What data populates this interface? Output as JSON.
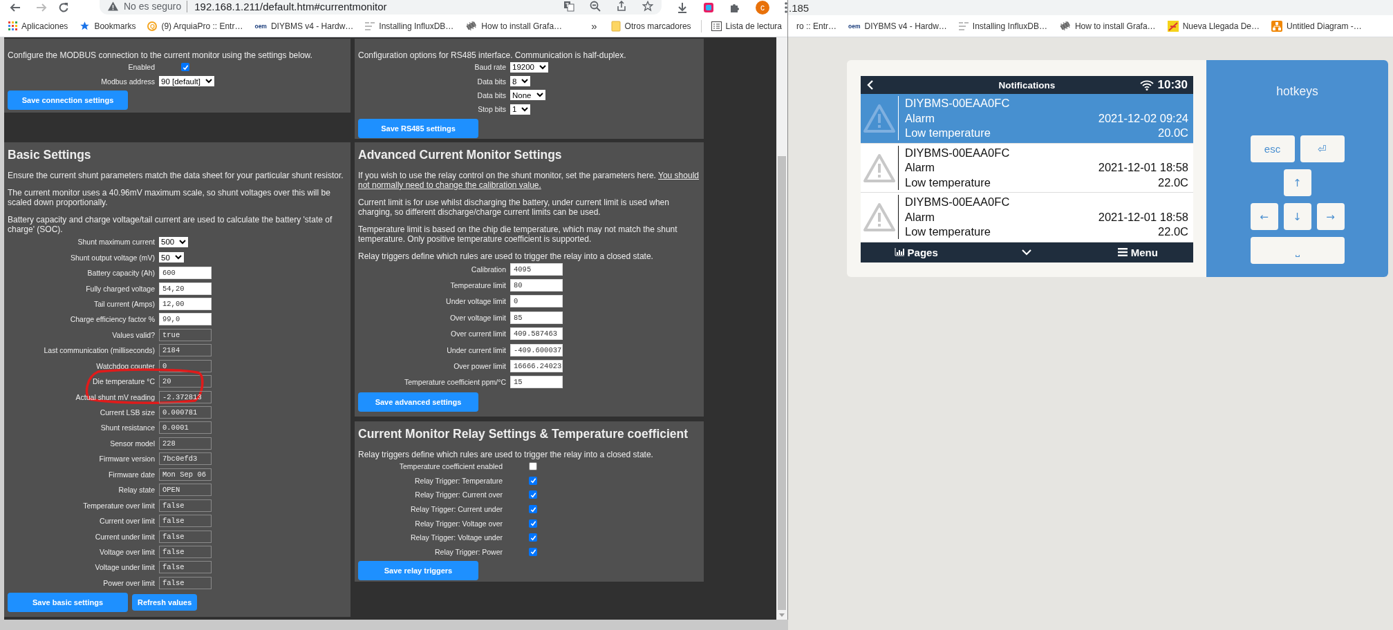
{
  "browser": {
    "security_label": "No es seguro",
    "url": "192.168.1.211/default.htm#currentmonitor",
    "profile_initial": "c",
    "bookmarks": [
      {
        "label": "Aplicaciones"
      },
      {
        "label": "Bookmarks"
      },
      {
        "label": "(9) ArquiaPro :: Entr…",
        "icon_text": "Q"
      },
      {
        "label": "DIYBMS v4 - Hardw…",
        "icon_text": "oem"
      },
      {
        "label": "Installing InfluxDB…"
      },
      {
        "label": "How to install Grafa…"
      }
    ],
    "overflow": "»",
    "other_bookmarks": "Otros marcadores",
    "reading_list": "Lista de lectura"
  },
  "modbus_panel": {
    "paragraphs": [
      {
        "text": "Configure the MODBUS connection to the current monitor using the settings below."
      }
    ],
    "fields": [
      {
        "kind": "checkbox",
        "label": "Enabled",
        "checked": true
      },
      {
        "kind": "select",
        "label": "Modbus address",
        "value": "90 [default]"
      }
    ],
    "buttons": [
      {
        "label": "Save connection settings",
        "kind": "wide"
      }
    ]
  },
  "rs485_panel": {
    "paragraphs": [
      {
        "text": "Configuration options for RS485 interface. Communication is half-duplex."
      }
    ],
    "fields": [
      {
        "kind": "select",
        "label": "Baud rate",
        "value": "19200"
      },
      {
        "kind": "select",
        "label": "Data bits",
        "value": "8"
      },
      {
        "kind": "select",
        "label": "Data bits",
        "value": "None"
      },
      {
        "kind": "select",
        "label": "Stop bits",
        "value": "1"
      }
    ],
    "buttons": [
      {
        "label": "Save RS485 settings",
        "kind": "wide"
      }
    ]
  },
  "basic_settings": {
    "title": "Basic Settings",
    "paragraphs": [
      {
        "text": "Ensure the current shunt parameters match the data sheet for your particular shunt resistor."
      },
      {
        "text": "The current monitor uses a 40.96mV maximum scale, so shunt voltages over this will be scaled down proportionally."
      },
      {
        "text": "Battery capacity and charge voltage/tail current are used to calculate the battery 'state of charge' (SOC)."
      }
    ],
    "fields": [
      {
        "kind": "select",
        "label": "Shunt maximum current",
        "value": "500"
      },
      {
        "kind": "select",
        "label": "Shunt output voltage (mV)",
        "value": "50"
      },
      {
        "kind": "input",
        "label": "Battery capacity (Ah)",
        "value": "600"
      },
      {
        "kind": "input",
        "label": "Fully charged voltage",
        "value": "54,20"
      },
      {
        "kind": "input",
        "label": "Tail current (Amps)",
        "value": "12,00"
      },
      {
        "kind": "input",
        "label": "Charge efficiency factor %",
        "value": "99,0"
      },
      {
        "kind": "readonly",
        "label": "Values valid?",
        "value": "true"
      },
      {
        "kind": "readonly",
        "label": "Last communication (milliseconds)",
        "value": "2184"
      },
      {
        "kind": "readonly",
        "label": "Watchdog counter",
        "value": "0"
      },
      {
        "kind": "readonly",
        "label": "Die temperature °C",
        "value": "20",
        "circled": true
      },
      {
        "kind": "readonly",
        "label": "Actual shunt mV reading",
        "value": "-2.372813"
      },
      {
        "kind": "readonly",
        "label": "Current LSB size",
        "value": "0.000781"
      },
      {
        "kind": "readonly",
        "label": "Shunt resistance",
        "value": "0.0001"
      },
      {
        "kind": "readonly",
        "label": "Sensor model",
        "value": "228"
      },
      {
        "kind": "readonly",
        "label": "Firmware version",
        "value": "7bc0efd3"
      },
      {
        "kind": "readonly",
        "label": "Firmware date",
        "value": "Mon Sep 06"
      },
      {
        "kind": "readonly",
        "label": "Relay state",
        "value": "OPEN"
      },
      {
        "kind": "readonly",
        "label": "Temperature over limit",
        "value": "false"
      },
      {
        "kind": "readonly",
        "label": "Current over limit",
        "value": "false"
      },
      {
        "kind": "readonly",
        "label": "Current under limit",
        "value": "false"
      },
      {
        "kind": "readonly",
        "label": "Voltage over limit",
        "value": "false"
      },
      {
        "kind": "readonly",
        "label": "Voltage under limit",
        "value": "false"
      },
      {
        "kind": "readonly",
        "label": "Power over limit",
        "value": "false"
      }
    ],
    "buttons": [
      {
        "label": "Save basic settings",
        "kind": "wide"
      },
      {
        "label": "Refresh values",
        "kind": "compact"
      }
    ]
  },
  "advanced_settings": {
    "title": "Advanced Current Monitor Settings",
    "paragraphs": [
      {
        "text": "If you wish to use the relay control on the shunt monitor, set the parameters here.",
        "underlined": "You should not normally need to change the calibration value."
      },
      {
        "text": "Current limit is for use whilst discharging the battery, under current limit is used when charging, so different discharge/charge current limits can be used."
      },
      {
        "text": "Temperature limit is based on the chip die temperature, which may not match the shunt temperature. Only positive temperature coefficient is supported."
      },
      {
        "text": "Relay triggers define which rules are used to trigger the relay into a closed state."
      }
    ],
    "fields": [
      {
        "kind": "input",
        "label": "Calibration",
        "value": "4095"
      },
      {
        "kind": "input",
        "label": "Temperature limit",
        "value": "80"
      },
      {
        "kind": "input",
        "label": "Under voltage limit",
        "value": "0"
      },
      {
        "kind": "input",
        "label": "Over voltage limit",
        "value": "85"
      },
      {
        "kind": "input",
        "label": "Over current limit",
        "value": "409.587463"
      },
      {
        "kind": "input",
        "label": "Under current limit",
        "value": "-409.600037"
      },
      {
        "kind": "input",
        "label": "Over power limit",
        "value": "16666.24023"
      },
      {
        "kind": "input",
        "label": "Temperature coefficient ppm/°C",
        "value": "15"
      }
    ],
    "buttons": [
      {
        "label": "Save advanced settings",
        "kind": "wide"
      }
    ]
  },
  "relay_settings": {
    "title": "Current Monitor Relay Settings & Temperature coefficient",
    "paragraphs": [
      {
        "text": "Relay triggers define which rules are used to trigger the relay into a closed state."
      }
    ],
    "fields": [
      {
        "kind": "checkbox",
        "label": "Temperature coefficient enabled",
        "checked": false
      },
      {
        "kind": "checkbox",
        "label": "Relay Trigger: Temperature",
        "checked": true
      },
      {
        "kind": "checkbox",
        "label": "Relay Trigger: Current over",
        "checked": true
      },
      {
        "kind": "checkbox",
        "label": "Relay Trigger: Current under",
        "checked": true
      },
      {
        "kind": "checkbox",
        "label": "Relay Trigger: Voltage over",
        "checked": true
      },
      {
        "kind": "checkbox",
        "label": "Relay Trigger: Voltage under",
        "checked": true
      },
      {
        "kind": "checkbox",
        "label": "Relay Trigger: Power",
        "checked": true
      }
    ],
    "buttons": [
      {
        "label": "Save relay triggers",
        "kind": "wide"
      }
    ]
  },
  "background_browser": {
    "url": ".185",
    "bookmarks": [
      {
        "label": "ro :: Entr…"
      },
      {
        "label": "DIYBMS v4 - Hardw…",
        "icon_text": "oem"
      },
      {
        "label": "Installing InfluxDB…"
      },
      {
        "label": "How to install Grafa…"
      },
      {
        "label": "Nueva Llegada De…"
      },
      {
        "label": "Untitled Diagram -…"
      }
    ]
  },
  "remote_console": {
    "header": {
      "title": "Notifications",
      "time": "10:30"
    },
    "notifications": [
      {
        "device": "DIYBMS-00EAA0FC",
        "type": "Alarm",
        "date": "2021-12-02 09:24",
        "message": "Low temperature",
        "value": "20.0C",
        "selected": true
      },
      {
        "device": "DIYBMS-00EAA0FC",
        "type": "Alarm",
        "date": "2021-12-01 18:58",
        "message": "Low temperature",
        "value": "22.0C",
        "selected": false
      },
      {
        "device": "DIYBMS-00EAA0FC",
        "type": "Alarm",
        "date": "2021-12-01 18:58",
        "message": "Low temperature",
        "value": "22.0C",
        "selected": false
      }
    ],
    "footer": {
      "pages": "Pages",
      "menu": "Menu"
    }
  },
  "hotkeys": {
    "title": "hotkeys",
    "keys": [
      {
        "label": "esc"
      },
      {
        "label": "⏎"
      },
      {
        "label": "↑"
      },
      {
        "label": "←"
      },
      {
        "label": "↓"
      },
      {
        "label": "→"
      },
      {
        "label": "⎵"
      }
    ]
  }
}
